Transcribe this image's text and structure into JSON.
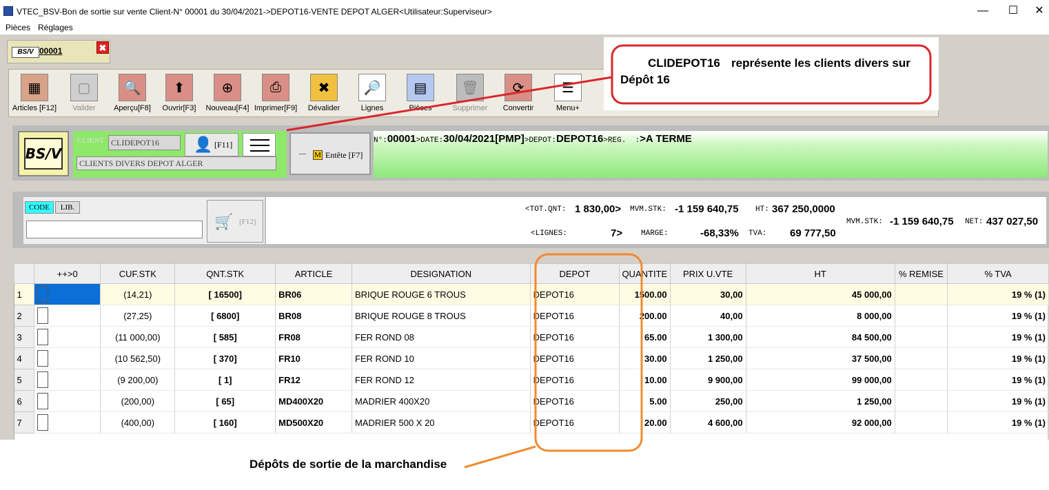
{
  "window": {
    "title": "VTEC_BSV-Bon de sortie sur vente Client-N° 00001 du 30/04/2021->DEPOT16-VENTE DEPOT ALGER<Utilisateur:Superviseur>",
    "min": "—",
    "max": "☐",
    "close": "✕"
  },
  "menu": {
    "items": [
      "Pièces",
      "Réglages"
    ]
  },
  "doctab": {
    "badge": "BS/V",
    "number": "00001",
    "close": "✖"
  },
  "toolbar": [
    {
      "label": "Articles [F12]",
      "icon": "articles-icon",
      "glyph": "▦"
    },
    {
      "label": "Valider",
      "icon": "validate-icon",
      "glyph": "▢"
    },
    {
      "label": "Aperçu[F8]",
      "icon": "preview-icon",
      "glyph": "🔍"
    },
    {
      "label": "Ouvrir[F3]",
      "icon": "open-icon",
      "glyph": "⬆"
    },
    {
      "label": "Nouveau[F4]",
      "icon": "new-icon",
      "glyph": "⊕"
    },
    {
      "label": "Imprimer[F9]",
      "icon": "print-icon",
      "glyph": "⎙"
    },
    {
      "label": "Dévalider",
      "icon": "unvalidate-icon",
      "glyph": "✖"
    },
    {
      "label": "Lignes",
      "icon": "lines-search-icon",
      "glyph": "🔎"
    },
    {
      "label": "Pièces",
      "icon": "pieces-icon",
      "glyph": "▤"
    },
    {
      "label": "Supprimer",
      "icon": "delete-icon",
      "glyph": "🗑"
    },
    {
      "label": "Convertir",
      "icon": "convert-icon",
      "glyph": "⟳"
    },
    {
      "label": "Menu+",
      "icon": "menu-icon",
      "glyph": "☰"
    }
  ],
  "client": {
    "label": "CLIENT",
    "code": "CLIDEPOT16",
    "name": "CLIENTS DIVERS DEPOT ALGER",
    "user_btn": "[F11]",
    "logo": "BS/V"
  },
  "entete": {
    "label": "Entête [F7]",
    "m": "M",
    "minus": "—"
  },
  "header": {
    "n_label": "N°:",
    "n_value": "00001",
    "date_label": ">DATE:",
    "date_value": "30/04/2021",
    "pmp": "[PMP]",
    "depot_label": ">DEPOT:",
    "depot_value": "DEPOT16",
    "reg_label": ">REG.  :",
    "reg_value": ">A TERME"
  },
  "search": {
    "code": "CODE",
    "lib": "LIB.",
    "cart": "[F12]"
  },
  "totals": {
    "tot_qnt_label": "<TOT.QNT:",
    "tot_qnt_value": "1 830,00>",
    "mvm_stk_label": "MVM.STK:",
    "mvm_stk_value": "-1 159 640,75",
    "ht_label": "HT:",
    "ht_value": "367 250,0000",
    "lignes_label": "<LIGNES:",
    "lignes_value": "7>",
    "marge_label": "MARGE:",
    "marge_value": "-68,33%",
    "tva_label": "TVA:",
    "tva_value": "69 777,50",
    "mvm_stk2_label": "MVM.STK:",
    "mvm_stk2_value": "-1 159 640,75",
    "net_label": "NET:",
    "net_value": "437 027,50"
  },
  "table": {
    "headers": [
      "",
      "++>0",
      "CUF.STK",
      "QNT.STK",
      "ARTICLE",
      "DESIGNATION",
      "DEPOT",
      "QUANTITE",
      "PRIX U.VTE",
      "HT",
      "% REMISE",
      "% TVA"
    ],
    "rows": [
      {
        "n": "1",
        "cuf": "(14,21)",
        "qnt": "[ 16500]",
        "article": "BR06",
        "designation": "BRIQUE ROUGE 6 TROUS",
        "depot": "DEPOT16",
        "quantite": "1500.00",
        "prix": "30,00",
        "ht": "45 000,00",
        "remise": "",
        "tva": "19 % (1)"
      },
      {
        "n": "2",
        "cuf": "(27,25)",
        "qnt": "[ 6800]",
        "article": "BR08",
        "designation": "BRIQUE ROUGE 8 TROUS",
        "depot": "DEPOT16",
        "quantite": "200.00",
        "prix": "40,00",
        "ht": "8 000,00",
        "remise": "",
        "tva": "19 % (1)"
      },
      {
        "n": "3",
        "cuf": "(11 000,00)",
        "qnt": "[ 585]",
        "article": "FR08",
        "designation": "FER ROND 08",
        "depot": "DEPOT16",
        "quantite": "65.00",
        "prix": "1 300,00",
        "ht": "84 500,00",
        "remise": "",
        "tva": "19 % (1)"
      },
      {
        "n": "4",
        "cuf": "(10 562,50)",
        "qnt": "[ 370]",
        "article": "FR10",
        "designation": "FER ROND 10",
        "depot": "DEPOT16",
        "quantite": "30.00",
        "prix": "1 250,00",
        "ht": "37 500,00",
        "remise": "",
        "tva": "19 % (1)"
      },
      {
        "n": "5",
        "cuf": "(9 200,00)",
        "qnt": "[ 1]",
        "article": "FR12",
        "designation": "FER ROND 12",
        "depot": "DEPOT16",
        "quantite": "10.00",
        "prix": "9 900,00",
        "ht": "99 000,00",
        "remise": "",
        "tva": "19 % (1)"
      },
      {
        "n": "6",
        "cuf": "(200,00)",
        "qnt": "[ 65]",
        "article": "MD400X20",
        "designation": "MADRIER 400X20",
        "depot": "DEPOT16",
        "quantite": "5.00",
        "prix": "250,00",
        "ht": "1 250,00",
        "remise": "",
        "tva": "19 % (1)"
      },
      {
        "n": "7",
        "cuf": "(400,00)",
        "qnt": "[ 160]",
        "article": "MD500X20",
        "designation": "MADRIER 500 X 20",
        "depot": "DEPOT16",
        "quantite": "20.00",
        "prix": "4 600,00",
        "ht": "92 000,00",
        "remise": "",
        "tva": "19 % (1)"
      }
    ]
  },
  "annotations": {
    "callout_top_1": "CLIDEPOT16",
    "callout_top_2": "représente les clients divers sur",
    "callout_top_3": "Dépôt 16",
    "callout_bottom": "Dépôts de sortie de la marchandise",
    "red": "#d9262c",
    "orange": "#f08a30"
  }
}
